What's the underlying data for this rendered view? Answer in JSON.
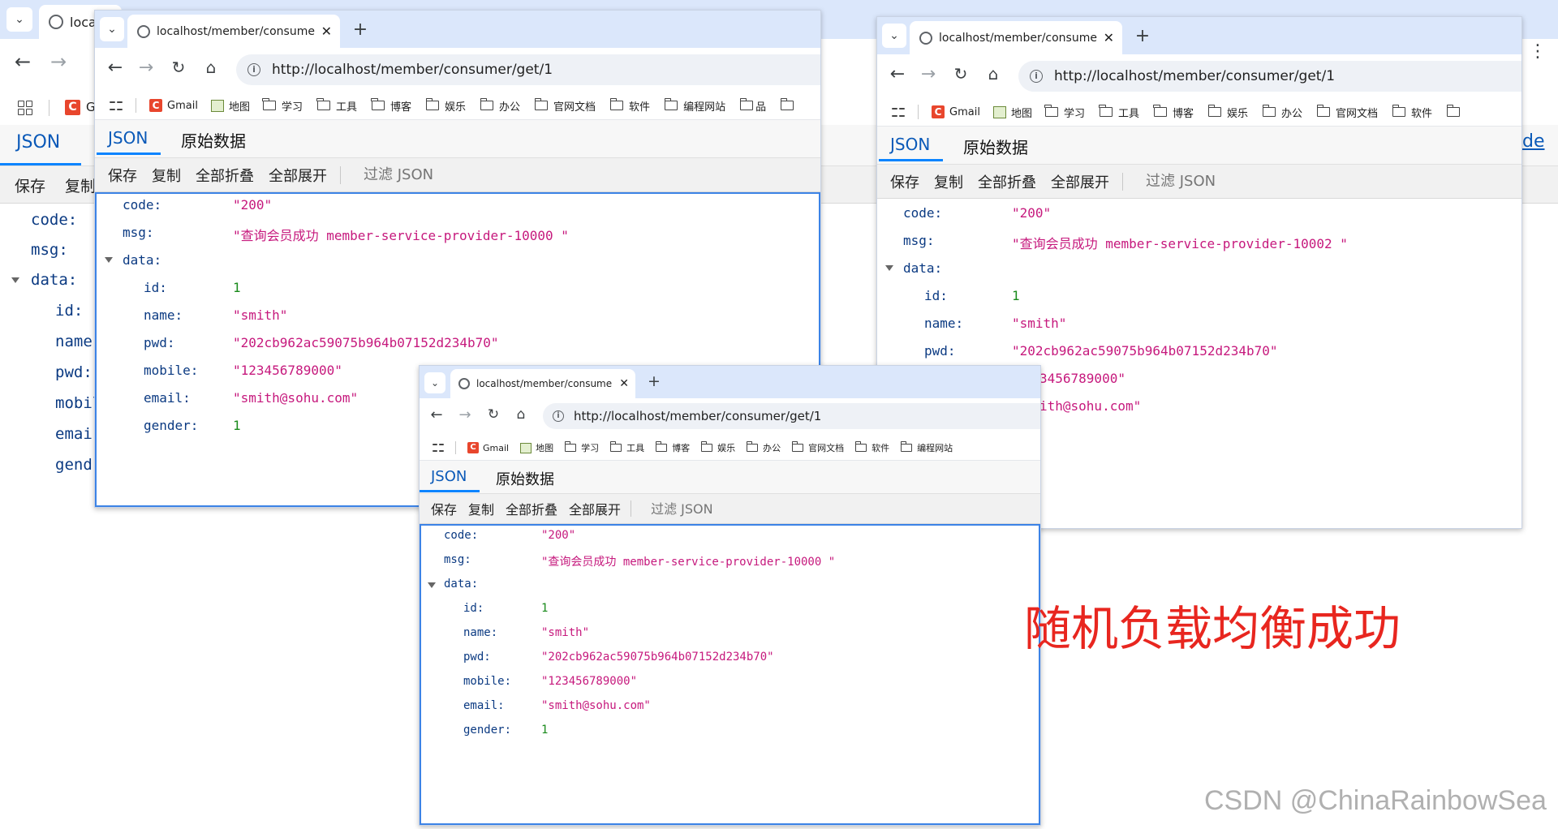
{
  "tab_title": "localhost/member/consumer/get/1",
  "tab_title_short": "localhost/member/consume",
  "url": "http://localhost/member/consumer/get/1",
  "bookmarks": [
    "Gmail",
    "地图",
    "学习",
    "工具",
    "博客",
    "娱乐",
    "办公",
    "官网文档",
    "软件",
    "编程网站",
    "品"
  ],
  "json_tabs": {
    "json": "JSON",
    "raw": "原始数据"
  },
  "toolbar": {
    "save": "保存",
    "copy": "复制",
    "collapse_all": "全部折叠",
    "expand_all": "全部展开",
    "filter": "过滤 JSON"
  },
  "keys": {
    "code": "code:",
    "msg": "msg:",
    "data": "data:",
    "id": "id:",
    "name": "name:",
    "pwd": "pwd:",
    "mobile": "mobile:",
    "email": "email:",
    "gender": "gender:"
  },
  "values": {
    "code": "\"200\"",
    "msg_10000": "\"查询会员成功 member-service-provider-10000 \"",
    "msg_10002": "\"查询会员成功 member-service-provider-10002 \"",
    "id": "1",
    "name": "\"smith\"",
    "pwd": "\"202cb962ac59075b964b07152d234b70\"",
    "mobile": "\"123456789000\"",
    "email": "\"smith@sohu.com\"",
    "gender": "1",
    "mobile_partial": "3456789000\"",
    "email_partial": "ith@sohu.com\""
  },
  "bg_window": {
    "tab_partial": "loca",
    "bookmark_partial": "G",
    "save": "保存",
    "copy_partial": "复制",
    "keys": {
      "code": "code:",
      "msg": "msg:",
      "data": "data:",
      "id": "id:",
      "name": "name",
      "pwd": "pwd:",
      "mobile": "mobil",
      "email": "emai",
      "gender": "gend"
    },
    "link_partial": "de"
  },
  "caption": "随机负载均衡成功",
  "watermark": "CSDN @ChinaRainbowSea",
  "icons": [
    "chevron-down-icon",
    "globe-icon",
    "close-icon",
    "plus-icon",
    "back-arrow-icon",
    "forward-arrow-icon",
    "reload-icon",
    "home-icon",
    "info-icon",
    "apps-grid-icon",
    "csdn-icon",
    "map-icon",
    "folder-icon",
    "triangle-expand-icon",
    "kebab-menu-icon"
  ],
  "colors": {
    "tabbar": "#dbe7fb",
    "json_key": "#0b3a82",
    "json_string": "#c6197d",
    "json_number": "#198a1b",
    "accent": "#0a84ff",
    "caption": "#e8261f"
  }
}
